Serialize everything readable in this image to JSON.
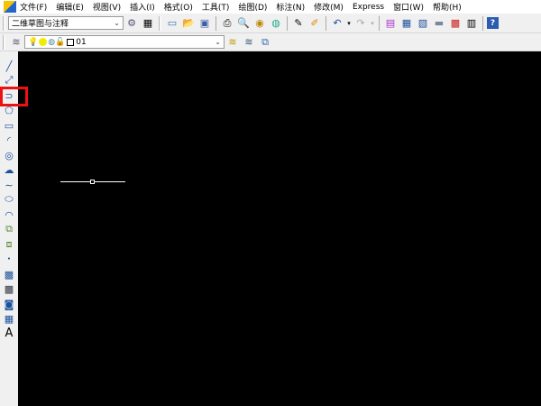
{
  "menubar": {
    "items": [
      "文件(F)",
      "编辑(E)",
      "视图(V)",
      "插入(I)",
      "格式(O)",
      "工具(T)",
      "绘图(D)",
      "标注(N)",
      "修改(M)",
      "Express",
      "窗口(W)",
      "帮助(H)"
    ]
  },
  "toolbar": {
    "workspace": "二维草图与注释",
    "layer": "01"
  },
  "left_toolbar": {
    "icons": [
      "line-icon",
      "construction-line-icon",
      "polyline-icon",
      "polygon-icon",
      "rectangle-icon",
      "arc-icon",
      "circle-icon",
      "revision-cloud-icon",
      "spline-icon",
      "ellipse-icon",
      "ellipse-arc-icon",
      "insert-block-icon",
      "make-block-icon",
      "point-icon",
      "hatch-icon",
      "gradient-icon",
      "region-icon",
      "table-icon",
      "multiline-text-icon"
    ],
    "text_label": "A",
    "highlighted": "polyline-icon"
  },
  "colors": {
    "canvas": "#000000",
    "highlight": "#e11111"
  }
}
